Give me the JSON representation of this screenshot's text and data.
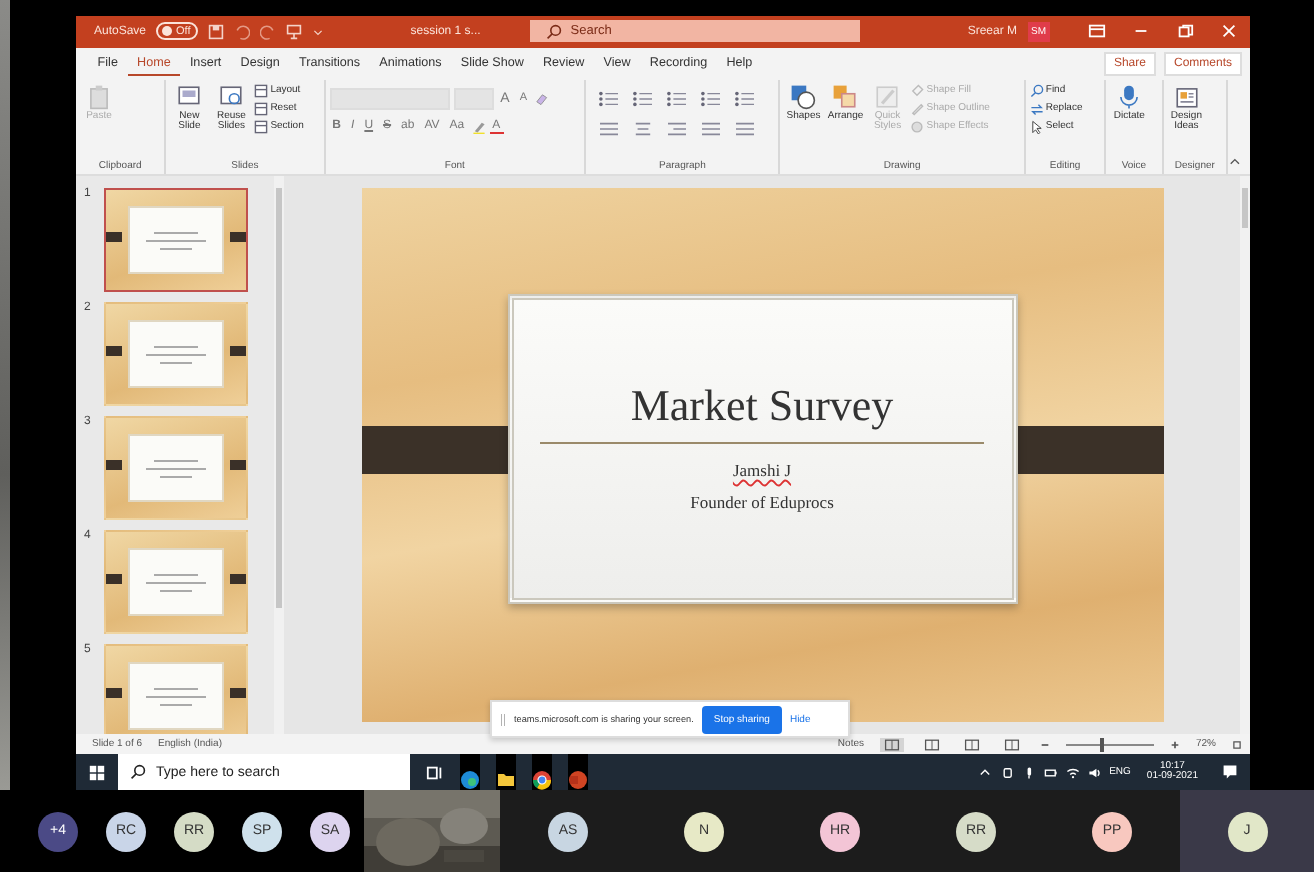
{
  "title_bar": {
    "autosave": {
      "label": "AutoSave",
      "on": false,
      "state_text": "Off"
    },
    "file_name": "session 1 s...",
    "search": {
      "placeholder": "Search"
    },
    "user_name": "Sreear M",
    "user_initials": "SM"
  },
  "tabs": [
    {
      "label": "File",
      "selected": false
    },
    {
      "label": "Home",
      "selected": true
    },
    {
      "label": "Insert",
      "selected": false
    },
    {
      "label": "Design",
      "selected": false
    },
    {
      "label": "Transitions",
      "selected": false
    },
    {
      "label": "Animations",
      "selected": false
    },
    {
      "label": "Slide Show",
      "selected": false
    },
    {
      "label": "Review",
      "selected": false
    },
    {
      "label": "View",
      "selected": false
    },
    {
      "label": "Recording",
      "selected": false
    },
    {
      "label": "Help",
      "selected": false
    }
  ],
  "share_button": "Share",
  "comments_button": "Comments",
  "ribbon": [
    {
      "kind": "clipboard",
      "name": "Clipboard",
      "large": [
        {
          "label": "Paste",
          "disabled": true
        }
      ]
    },
    {
      "kind": "slides",
      "name": "Slides",
      "large": [
        {
          "label": "New Slide",
          "disabled": false
        },
        {
          "label": "Reuse Slides",
          "disabled": false
        }
      ],
      "small": [
        {
          "label": "Layout",
          "disabled": false
        },
        {
          "label": "Reset",
          "disabled": false
        },
        {
          "label": "Section",
          "disabled": false
        }
      ]
    },
    {
      "kind": "font",
      "name": "Font",
      "size_buttons": [
        "A",
        "A"
      ],
      "format_buttons": [
        "B",
        "I",
        "U",
        "S",
        "ab",
        "AV",
        "Aa"
      ],
      "color_button": "A"
    },
    {
      "kind": "paragraph",
      "name": "Paragraph"
    },
    {
      "kind": "drawing",
      "name": "Drawing",
      "large": [
        {
          "label": "Shapes",
          "disabled": false
        },
        {
          "label": "Arrange",
          "disabled": false
        },
        {
          "label": "Quick Styles",
          "disabled": true
        }
      ],
      "small": [
        {
          "label": "Shape Fill",
          "disabled": true
        },
        {
          "label": "Shape Outline",
          "disabled": true
        },
        {
          "label": "Shape Effects",
          "disabled": true
        }
      ]
    },
    {
      "kind": "editing",
      "name": "Editing",
      "small": [
        {
          "label": "Find",
          "disabled": false
        },
        {
          "label": "Replace",
          "disabled": false
        },
        {
          "label": "Select",
          "disabled": false
        }
      ]
    },
    {
      "kind": "voice",
      "name": "Voice",
      "large": [
        {
          "label": "Dictate",
          "disabled": false
        }
      ]
    },
    {
      "kind": "designer",
      "name": "Designer",
      "large": [
        {
          "label": "Design Ideas",
          "disabled": false
        }
      ]
    }
  ],
  "slides": [
    {
      "number": "1",
      "selected": true
    },
    {
      "number": "2",
      "selected": false
    },
    {
      "number": "3",
      "selected": false
    },
    {
      "number": "4",
      "selected": false
    },
    {
      "number": "5",
      "selected": false
    }
  ],
  "slide": {
    "title": "Market Survey",
    "author": "Jamshi J",
    "subtitle": "Founder of Eduprocs"
  },
  "sharing_bar": {
    "message": "teams.microsoft.com is sharing your screen.",
    "stop_button": "Stop sharing",
    "hide_link": "Hide"
  },
  "status_bar": {
    "slide_count": "Slide 1 of 6",
    "language": "English (India)",
    "notes_button": "Notes",
    "views": [
      {
        "selected": true
      },
      {
        "selected": false
      },
      {
        "selected": false
      },
      {
        "selected": false
      }
    ],
    "zoom": {
      "level": 0.42,
      "reading": "72%"
    }
  },
  "taskbar": {
    "search": {
      "placeholder": "Type here to search"
    },
    "language": "ENG",
    "time": "10:17",
    "date": "01-09-2021"
  },
  "participants": [
    {
      "kind": "overflow",
      "initials": "+4",
      "color": "#4b4a86"
    },
    {
      "kind": "small",
      "initials": "RC",
      "color": "#c9d5e8"
    },
    {
      "kind": "small",
      "initials": "RR",
      "color": "#d5dcc6"
    },
    {
      "kind": "small",
      "initials": "SP",
      "color": "#cfe1ec"
    },
    {
      "kind": "small",
      "initials": "SA",
      "color": "#ddd4ef"
    },
    {
      "kind": "video"
    },
    {
      "kind": "tile",
      "initials": "AS",
      "color": "#c8d6e2",
      "highlighted": false
    },
    {
      "kind": "tile",
      "initials": "N",
      "color": "#e7e9c6",
      "highlighted": false
    },
    {
      "kind": "tile",
      "initials": "HR",
      "color": "#f3c5d6",
      "highlighted": false
    },
    {
      "kind": "tile",
      "initials": "RR",
      "color": "#d6dcc8",
      "highlighted": false
    },
    {
      "kind": "tile",
      "initials": "PP",
      "color": "#f8c8bf",
      "highlighted": false
    },
    {
      "kind": "tile",
      "initials": "J",
      "color": "#e1e7c8",
      "highlighted": true
    }
  ]
}
